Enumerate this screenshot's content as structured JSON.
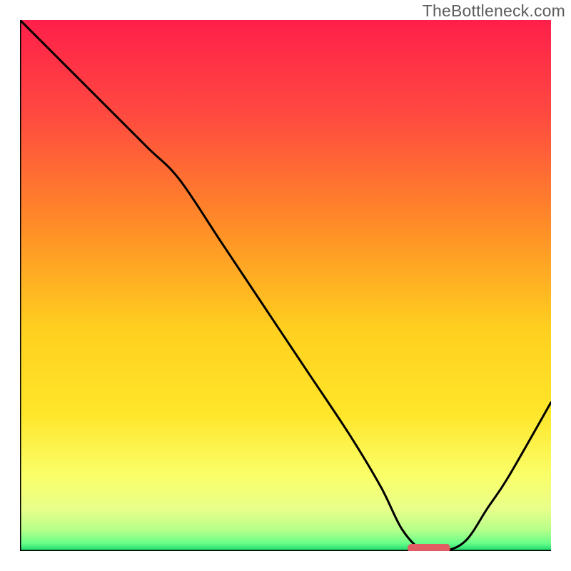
{
  "watermark": "TheBottleneck.com",
  "chart_data": {
    "type": "line",
    "title": "",
    "xlabel": "",
    "ylabel": "",
    "xlim": [
      0,
      100
    ],
    "ylim": [
      0,
      100
    ],
    "series": [
      {
        "name": "curve",
        "x": [
          0,
          8,
          16,
          24,
          30,
          38,
          46,
          54,
          62,
          68,
          72,
          76,
          80,
          84,
          88,
          92,
          100
        ],
        "y": [
          100,
          92,
          84,
          76,
          70,
          58,
          46,
          34,
          22,
          12,
          4,
          0,
          0,
          2,
          8,
          14,
          28
        ]
      }
    ],
    "marker": {
      "x_center": 77,
      "width": 8,
      "y": 0,
      "color": "#e15d63"
    },
    "gradient_stops": [
      {
        "offset": 0.0,
        "color": "#ff1f4a"
      },
      {
        "offset": 0.18,
        "color": "#ff4a40"
      },
      {
        "offset": 0.38,
        "color": "#ff8a28"
      },
      {
        "offset": 0.58,
        "color": "#ffcf1f"
      },
      {
        "offset": 0.74,
        "color": "#ffe62a"
      },
      {
        "offset": 0.86,
        "color": "#faff6a"
      },
      {
        "offset": 0.92,
        "color": "#e9ff8a"
      },
      {
        "offset": 0.96,
        "color": "#b6ff8a"
      },
      {
        "offset": 0.985,
        "color": "#6bff8a"
      },
      {
        "offset": 1.0,
        "color": "#18d668"
      }
    ]
  }
}
